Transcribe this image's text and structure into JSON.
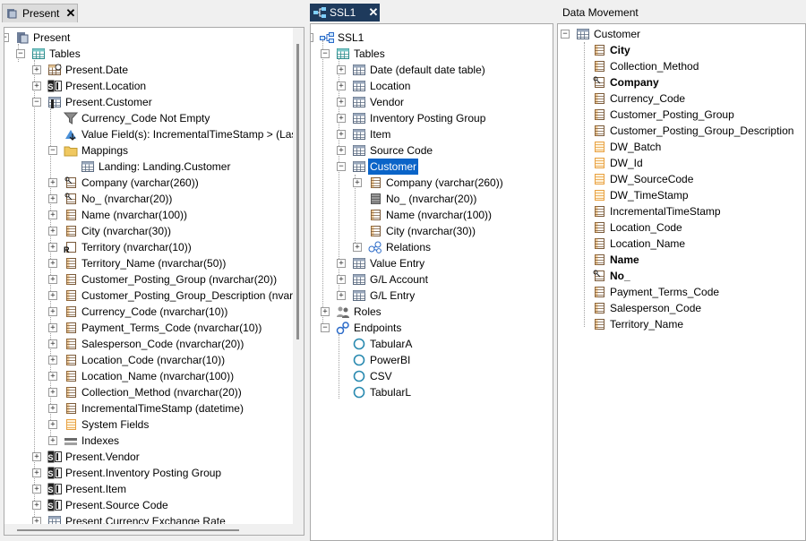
{
  "left_panel": {
    "tab_label": "Present",
    "root": "Present",
    "tables_label": "Tables",
    "rows": [
      {
        "text": "Present.Date",
        "icon": "date-table-icon",
        "level": 2,
        "exp": "+"
      },
      {
        "text": "Present.Location",
        "icon": "si-table-icon",
        "level": 2,
        "exp": "+"
      },
      {
        "text": "Present.Customer",
        "icon": "key-table-icon",
        "level": 2,
        "exp": "-"
      },
      {
        "text": "Currency_Code Not Empty",
        "icon": "filter-icon",
        "level": 3,
        "exp": ""
      },
      {
        "text": "Value Field(s): IncrementalTimeStamp > (Last r",
        "icon": "value-field-icon",
        "level": 3,
        "exp": ""
      },
      {
        "text": "Mappings",
        "icon": "folder-icon",
        "level": 3,
        "exp": "-"
      },
      {
        "text": "Landing: Landing.Customer",
        "icon": "table-icon",
        "level": 4,
        "exp": ""
      },
      {
        "text": "Company (varchar(260))",
        "icon": "key-column-icon",
        "level": 3,
        "exp": "+"
      },
      {
        "text": "No_ (nvarchar(20))",
        "icon": "key-column-icon",
        "level": 3,
        "exp": "+"
      },
      {
        "text": "Name (nvarchar(100))",
        "icon": "column-icon",
        "level": 3,
        "exp": "+"
      },
      {
        "text": "City (nvarchar(30))",
        "icon": "column-icon",
        "level": 3,
        "exp": "+"
      },
      {
        "text": "Territory (nvarchar(10))",
        "icon": "r-column-icon",
        "level": 3,
        "exp": "+"
      },
      {
        "text": "Territory_Name (nvarchar(50))",
        "icon": "column-icon",
        "level": 3,
        "exp": "+"
      },
      {
        "text": "Customer_Posting_Group (nvarchar(20))",
        "icon": "column-icon",
        "level": 3,
        "exp": "+"
      },
      {
        "text": "Customer_Posting_Group_Description (nvarch",
        "icon": "column-icon",
        "level": 3,
        "exp": "+"
      },
      {
        "text": "Currency_Code (nvarchar(10))",
        "icon": "column-icon",
        "level": 3,
        "exp": "+"
      },
      {
        "text": "Payment_Terms_Code (nvarchar(10))",
        "icon": "column-icon",
        "level": 3,
        "exp": "+"
      },
      {
        "text": "Salesperson_Code (nvarchar(20))",
        "icon": "column-icon",
        "level": 3,
        "exp": "+"
      },
      {
        "text": "Location_Code (nvarchar(10))",
        "icon": "column-icon",
        "level": 3,
        "exp": "+"
      },
      {
        "text": "Location_Name (nvarchar(100))",
        "icon": "column-icon",
        "level": 3,
        "exp": "+"
      },
      {
        "text": "Collection_Method (nvarchar(20))",
        "icon": "column-icon",
        "level": 3,
        "exp": "+"
      },
      {
        "text": "IncrementalTimeStamp (datetime)",
        "icon": "column-icon",
        "level": 3,
        "exp": "+"
      },
      {
        "text": "System Fields",
        "icon": "system-fields-icon",
        "level": 3,
        "exp": "+"
      },
      {
        "text": "Indexes",
        "icon": "indexes-icon",
        "level": 3,
        "exp": "+"
      },
      {
        "text": "Present.Vendor",
        "icon": "si-table-icon",
        "level": 2,
        "exp": "+"
      },
      {
        "text": "Present.Inventory Posting Group",
        "icon": "si-table-icon",
        "level": 2,
        "exp": "+"
      },
      {
        "text": "Present.Item",
        "icon": "si-table-icon",
        "level": 2,
        "exp": "+"
      },
      {
        "text": "Present.Source Code",
        "icon": "si-table-icon",
        "level": 2,
        "exp": "+"
      },
      {
        "text": "Present.Currency Exchange Rate",
        "icon": "table-icon",
        "level": 2,
        "exp": "+"
      }
    ]
  },
  "mid_panel": {
    "tab_label": "SSL1",
    "root": "SSL1",
    "rows": [
      {
        "text": "Tables",
        "icon": "tables-icon",
        "level": 1,
        "exp": "-"
      },
      {
        "text": "Date (default date table)",
        "icon": "table-icon",
        "level": 2,
        "exp": "+"
      },
      {
        "text": "Location",
        "icon": "table-icon",
        "level": 2,
        "exp": "+"
      },
      {
        "text": "Vendor",
        "icon": "table-icon",
        "level": 2,
        "exp": "+"
      },
      {
        "text": "Inventory Posting Group",
        "icon": "table-icon",
        "level": 2,
        "exp": "+"
      },
      {
        "text": "Item",
        "icon": "table-icon",
        "level": 2,
        "exp": "+"
      },
      {
        "text": "Source Code",
        "icon": "table-icon",
        "level": 2,
        "exp": "+"
      },
      {
        "text": "Customer",
        "icon": "table-icon",
        "level": 2,
        "exp": "-",
        "selected": true
      },
      {
        "text": "Company (varchar(260))",
        "icon": "column-icon",
        "level": 3,
        "exp": "+"
      },
      {
        "text": "No_ (nvarchar(20))",
        "icon": "hidden-column-icon",
        "level": 3,
        "exp": ""
      },
      {
        "text": "Name (nvarchar(100))",
        "icon": "column-icon",
        "level": 3,
        "exp": ""
      },
      {
        "text": "City (nvarchar(30))",
        "icon": "column-icon",
        "level": 3,
        "exp": ""
      },
      {
        "text": "Relations",
        "icon": "relations-icon",
        "level": 3,
        "exp": "+"
      },
      {
        "text": "Value Entry",
        "icon": "table-icon",
        "level": 2,
        "exp": "+"
      },
      {
        "text": "G/L Account",
        "icon": "table-icon",
        "level": 2,
        "exp": "+"
      },
      {
        "text": "G/L Entry",
        "icon": "table-icon",
        "level": 2,
        "exp": "+"
      },
      {
        "text": "Roles",
        "icon": "roles-icon",
        "level": 1,
        "exp": "+"
      },
      {
        "text": "Endpoints",
        "icon": "endpoints-icon",
        "level": 1,
        "exp": "-"
      },
      {
        "text": "TabularA",
        "icon": "endpoint-circle-icon",
        "level": 2,
        "exp": ""
      },
      {
        "text": "PowerBI",
        "icon": "endpoint-circle-icon",
        "level": 2,
        "exp": ""
      },
      {
        "text": "CSV",
        "icon": "endpoint-circle-icon",
        "level": 2,
        "exp": ""
      },
      {
        "text": "TabularL",
        "icon": "endpoint-circle-icon",
        "level": 2,
        "exp": ""
      }
    ]
  },
  "right_panel": {
    "title": "Data Movement",
    "root": "Customer",
    "rows": [
      {
        "text": "City",
        "bold": true,
        "icon": "column-icon"
      },
      {
        "text": "Collection_Method",
        "bold": false,
        "icon": "column-icon"
      },
      {
        "text": "Company",
        "bold": true,
        "icon": "key-column-icon"
      },
      {
        "text": "Currency_Code",
        "bold": false,
        "icon": "column-icon"
      },
      {
        "text": "Customer_Posting_Group",
        "bold": false,
        "icon": "column-icon"
      },
      {
        "text": "Customer_Posting_Group_Description",
        "bold": false,
        "icon": "column-icon"
      },
      {
        "text": "DW_Batch",
        "bold": false,
        "icon": "system-column-icon"
      },
      {
        "text": "DW_Id",
        "bold": false,
        "icon": "system-column-icon"
      },
      {
        "text": "DW_SourceCode",
        "bold": false,
        "icon": "system-column-icon"
      },
      {
        "text": "DW_TimeStamp",
        "bold": false,
        "icon": "system-column-icon"
      },
      {
        "text": "IncrementalTimeStamp",
        "bold": false,
        "icon": "column-icon"
      },
      {
        "text": "Location_Code",
        "bold": false,
        "icon": "column-icon"
      },
      {
        "text": "Location_Name",
        "bold": false,
        "icon": "column-icon"
      },
      {
        "text": "Name",
        "bold": true,
        "icon": "column-icon"
      },
      {
        "text": "No_",
        "bold": true,
        "icon": "key-column-icon"
      },
      {
        "text": "Payment_Terms_Code",
        "bold": false,
        "icon": "column-icon"
      },
      {
        "text": "Salesperson_Code",
        "bold": false,
        "icon": "column-icon"
      },
      {
        "text": "Territory_Name",
        "bold": false,
        "icon": "column-icon"
      }
    ]
  },
  "colors": {
    "selection": "#0a64c8",
    "tab_active": "#1e3a5c",
    "teal_column": "#2a8c8c",
    "system_orange": "#e8a040"
  }
}
